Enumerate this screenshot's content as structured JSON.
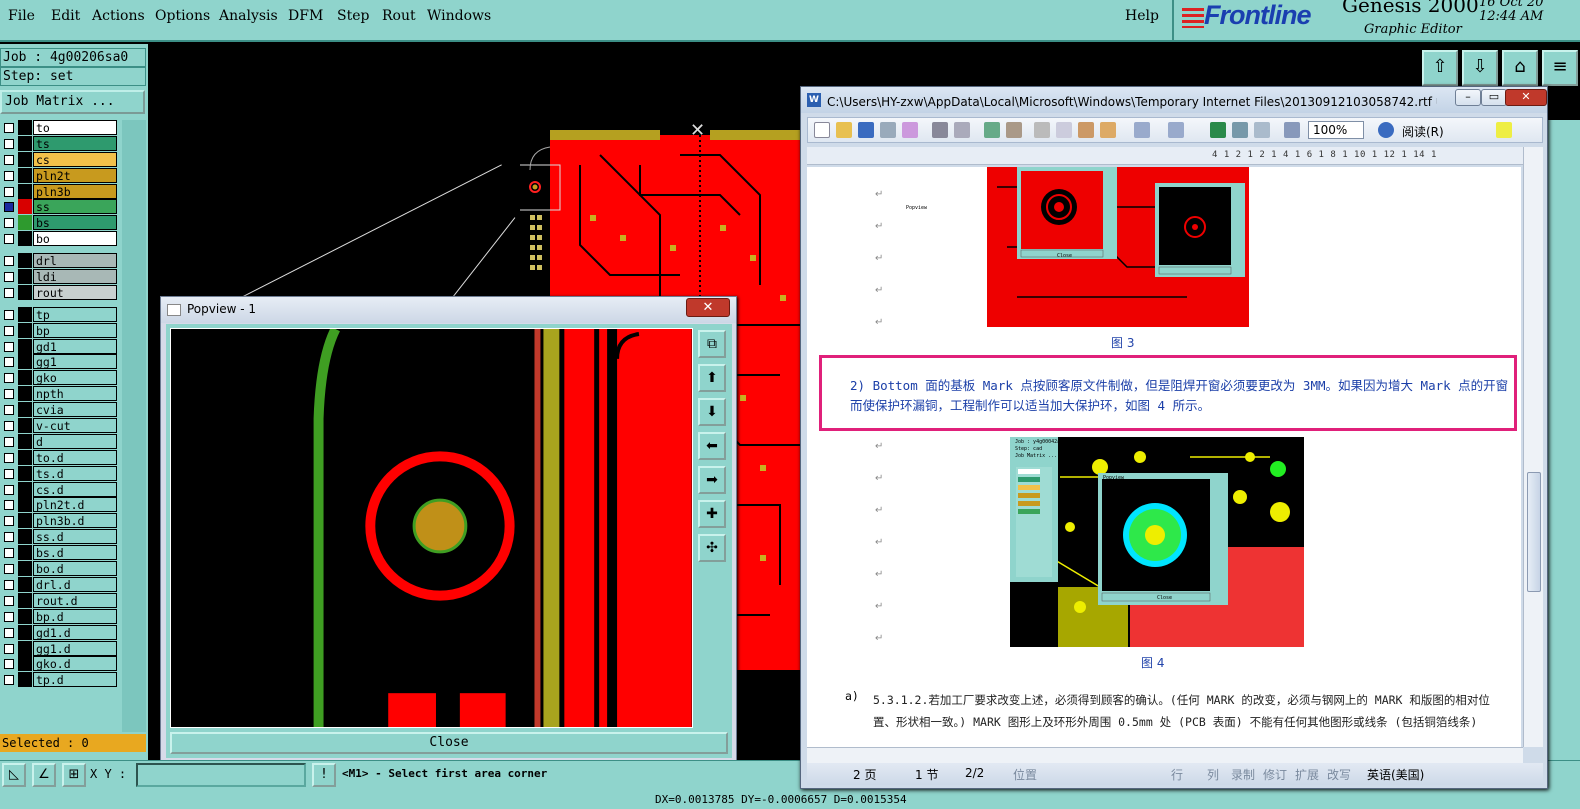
{
  "menu": {
    "items": [
      "File",
      "Edit",
      "Actions",
      "Options",
      "Analysis",
      "DFM",
      "Step",
      "Rout",
      "Windows"
    ],
    "help": "Help"
  },
  "brand": {
    "logo": "Frontline",
    "product": "Genesis 2000",
    "subtitle": "Graphic Editor",
    "date": "16 Oct 20",
    "time": "12:44 AM"
  },
  "left_panel": {
    "job": "Job : 4g00206sa0",
    "step": "Step: set",
    "job_matrix": "Job Matrix ...",
    "selected": "Selected : 0",
    "layers": [
      {
        "name": "to",
        "bg": "#ffffff"
      },
      {
        "name": "ts",
        "bg": "#2e9a6e"
      },
      {
        "name": "cs",
        "bg": "#f2c14a"
      },
      {
        "name": "pln2t",
        "bg": "#c89a1e"
      },
      {
        "name": "pln3b",
        "bg": "#c89a1e"
      },
      {
        "name": "ss",
        "bg": "#3aa55a"
      },
      {
        "name": "bs",
        "bg": "#2e9a6e"
      },
      {
        "name": "bo",
        "bg": "#ffffff"
      },
      {
        "name": "drl",
        "bg": "#a8b8b6"
      },
      {
        "name": "ldi",
        "bg": "#a8b8b6"
      },
      {
        "name": "rout",
        "bg": "#c8d0cf"
      },
      {
        "name": "tp",
        "bg": "#8fd4cc"
      },
      {
        "name": "bp",
        "bg": "#8fd4cc"
      },
      {
        "name": "gd1",
        "bg": "#8fd4cc"
      },
      {
        "name": "gg1",
        "bg": "#8fd4cc"
      },
      {
        "name": "gko",
        "bg": "#8fd4cc"
      },
      {
        "name": "npth",
        "bg": "#8fd4cc"
      },
      {
        "name": "cvia",
        "bg": "#8fd4cc"
      },
      {
        "name": "v-cut",
        "bg": "#8fd4cc"
      },
      {
        "name": "d",
        "bg": "#8fd4cc"
      },
      {
        "name": "to.d",
        "bg": "#8fd4cc"
      },
      {
        "name": "ts.d",
        "bg": "#8fd4cc"
      },
      {
        "name": "cs.d",
        "bg": "#8fd4cc"
      },
      {
        "name": "pln2t.d",
        "bg": "#8fd4cc"
      },
      {
        "name": "pln3b.d",
        "bg": "#8fd4cc"
      },
      {
        "name": "ss.d",
        "bg": "#8fd4cc"
      },
      {
        "name": "bs.d",
        "bg": "#8fd4cc"
      },
      {
        "name": "bo.d",
        "bg": "#8fd4cc"
      },
      {
        "name": "drl.d",
        "bg": "#8fd4cc"
      },
      {
        "name": "rout.d",
        "bg": "#8fd4cc"
      },
      {
        "name": "bp.d",
        "bg": "#8fd4cc"
      },
      {
        "name": "gd1.d",
        "bg": "#8fd4cc"
      },
      {
        "name": "gg1.d",
        "bg": "#8fd4cc"
      },
      {
        "name": "gko.d",
        "bg": "#8fd4cc"
      },
      {
        "name": "tp.d",
        "bg": "#8fd4cc"
      }
    ]
  },
  "popview": {
    "title": "Popview - 1",
    "close_label": "Close",
    "close_x": "✕"
  },
  "bottom": {
    "xy_label": "X Y :",
    "status": "<M1> - Select first area corner",
    "coords": "DX=0.0013785 DY=-0.0006657 D=0.0015354"
  },
  "word": {
    "title": "C:\\Users\\HY-zxw\\AppData\\Local\\Microsoft\\Windows\\Temporary Internet Files\\20130912103058742.rtf 中...",
    "zoom": "100%",
    "read_mode": "阅读(R)",
    "ruler": "4 1 2 1      2 1 4 1 6 1 8 1 10 1 12 1 14 1",
    "fig3_caption": "图 3",
    "fig4_caption": "图 4",
    "callout": "2) Bottom 面的基板 Mark 点按顾客原文件制做，但是阻焊开窗必须要更改为 3MM。如果因为增大 Mark 点的开窗而使保护环漏铜，工程制作可以适当加大保护环，如图 4 所示。",
    "para_marker": "a)",
    "para_a": "5.3.1.2.若加工厂要求改变上述，必须得到顾客的确认。(任何 MARK 的改变，必须与钢网上的 MARK 和版图的相对位置、形状相一致。) MARK 图形上及环形外周围 0.5mm 处 (PCB 表面) 不能有任何其他图形或线条 (包括铜箔线条)",
    "status": {
      "page": "2 页",
      "section": "1 节",
      "pages": "2/2",
      "position": "位置",
      "row": "行",
      "col": "列",
      "rec": "录制",
      "trk": "修订",
      "ext": "扩展",
      "ovr": "改写",
      "lang": "英语(美国)"
    }
  },
  "mini_popview": {
    "title": "Popview",
    "close": "Close"
  },
  "mini_job": {
    "job": "Job : y4g00042a",
    "step": "Step: cad",
    "matrix": "Job Matrix ..."
  }
}
